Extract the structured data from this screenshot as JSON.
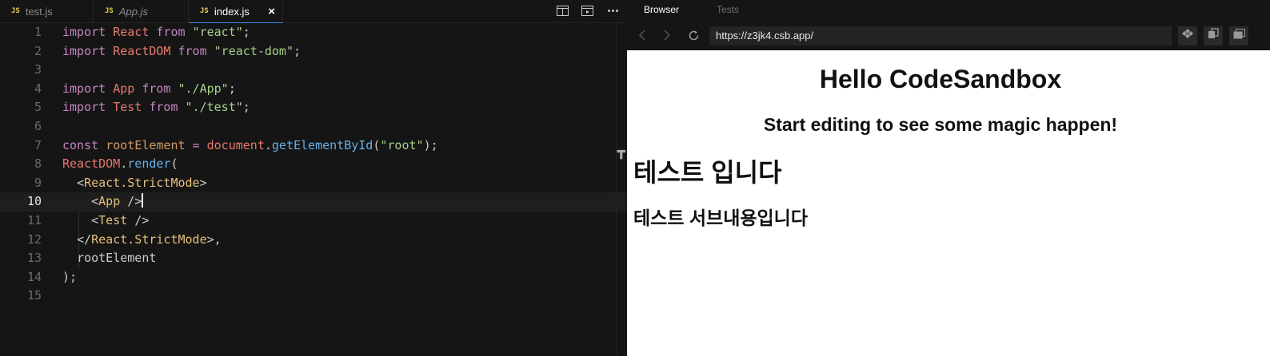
{
  "editor": {
    "tabs": [
      {
        "badge": "JS",
        "label": "test.js"
      },
      {
        "badge": "JS",
        "label": "App.js"
      },
      {
        "badge": "JS",
        "label": "index.js",
        "close": "×"
      }
    ],
    "toolbar_icons": [
      "split-view-icon",
      "preview-icon",
      "more-icon"
    ],
    "line_numbers": [
      "1",
      "2",
      "3",
      "4",
      "5",
      "6",
      "7",
      "8",
      "9",
      "10",
      "11",
      "12",
      "13",
      "14",
      "15"
    ],
    "current_line": "10"
  },
  "preview": {
    "tabs": [
      "Browser",
      "Tests"
    ],
    "url": "https://z3jk4.csb.app/",
    "heading": "Hello CodeSandbox",
    "subheading": "Start editing to see some magic happen!",
    "test_heading": "테스트 입니다",
    "test_subheading": "테스트 서브내용입니다"
  }
}
